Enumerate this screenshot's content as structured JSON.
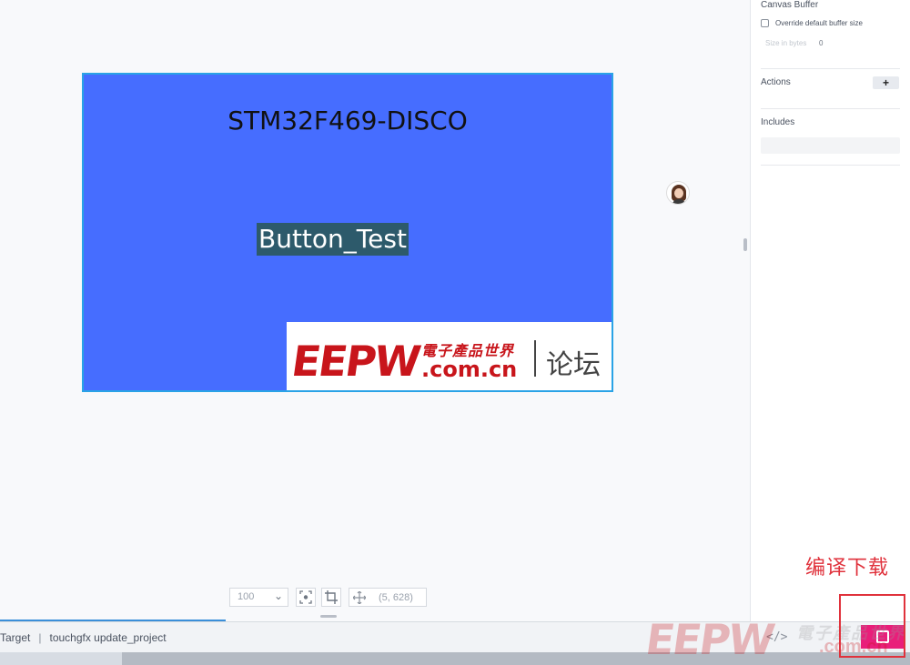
{
  "canvas": {
    "screen_title": "STM32F469-DISCO",
    "button_text": "Button_Test",
    "logo": {
      "letters": "EEPW",
      "chinese": "電子產品世界",
      "domain": ".com.cn",
      "forum": "论坛"
    }
  },
  "toolbar": {
    "zoom_value": "100",
    "coordinates": "(5, 628)"
  },
  "panel": {
    "canvas_buffer_heading": "Canvas Buffer",
    "override_label": "Override default buffer size",
    "override_checked": false,
    "size_label": "Size in bytes",
    "size_value": "0",
    "actions_heading": "Actions",
    "add_label": "+",
    "includes_heading": "Includes"
  },
  "status_bar": {
    "target_text": "Target",
    "command_text": "touchgfx update_project",
    "separator": "|",
    "code_icon": "</>"
  },
  "annotation": {
    "label": "编译下载"
  },
  "watermark": {
    "letters": "EEPW",
    "chinese": "電子產品世界",
    "domain": ".com.cn"
  },
  "colors": {
    "screen_bg": "#466dff",
    "screen_border": "#2aa3e6",
    "button_bg": "#2d5a6b",
    "compile_button": "#e91e7a",
    "annotation": "#e0323c",
    "logo_red": "#c8151b"
  }
}
